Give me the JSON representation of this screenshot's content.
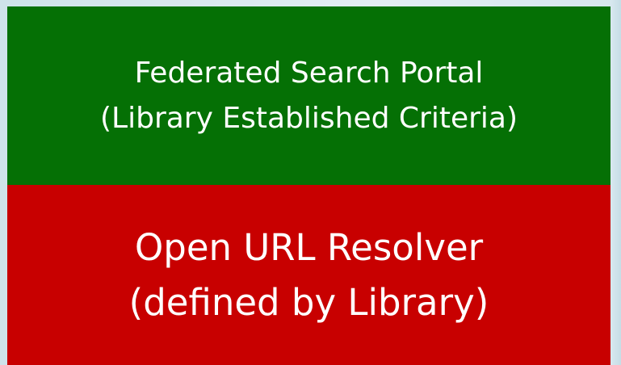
{
  "diagram": {
    "top_block": {
      "line1": "Federated Search Portal",
      "line2": "(Library Established Criteria)",
      "color": "#057005"
    },
    "bottom_block": {
      "line1": "Open URL Resolver",
      "line2": "(defined by Library)",
      "color": "#c80000"
    }
  }
}
